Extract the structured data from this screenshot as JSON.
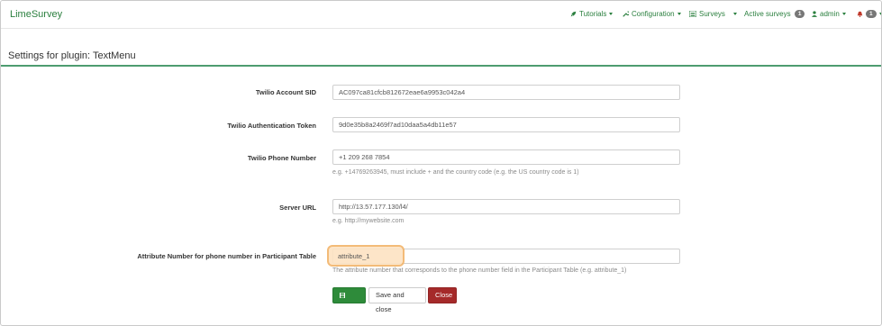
{
  "navbar": {
    "brand": "LimeSurvey",
    "tutorials": "Tutorials",
    "configuration": "Configuration",
    "surveys": "Surveys",
    "active_surveys": "Active surveys",
    "active_surveys_count": "1",
    "user": "admin",
    "notifications_count": "1"
  },
  "page": {
    "title": "Settings for plugin: TextMenu"
  },
  "form": {
    "account_sid_label": "Twilio Account SID",
    "account_sid_value": "AC097ca81cfcb812672eae6a9953c042a4",
    "auth_token_label": "Twilio Authentication Token",
    "auth_token_value": "9d0e35b8a2469f7ad10daa5a4db11e57",
    "phone_label": "Twilio Phone Number",
    "phone_value": "+1 209 268 7854",
    "phone_help": "e.g. +14769263945, must include + and the country code (e.g. the US country code is 1)",
    "server_label": "Server URL",
    "server_value": "http://13.57.177.130/l4/",
    "server_help": "e.g. http://mywebsite.com",
    "attr_label": "Attribute Number for phone number in Participant Table",
    "attr_value": "attribute_1",
    "attr_help": "The attribute number that corresponds to the phone number field in the Participant Table (e.g. attribute_1)"
  },
  "buttons": {
    "save": "Save",
    "save_close": "Save and close",
    "close": "Close"
  },
  "colors": {
    "brand_green": "#2a7f3e",
    "save_button": "#2e8b3a",
    "close_button": "#a52a2a",
    "highlight": "#f2b46a"
  }
}
